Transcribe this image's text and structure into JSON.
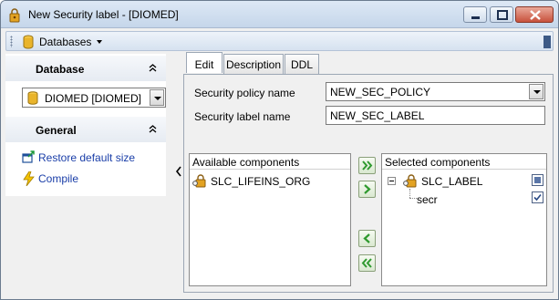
{
  "window": {
    "title": "New Security label - [DIOMED]"
  },
  "toolbar": {
    "databases_label": "Databases"
  },
  "sidebar": {
    "database_header": "Database",
    "database_selected": "DIOMED [DIOMED]",
    "general_header": "General",
    "links": [
      {
        "label": "Restore default size",
        "icon": "restore-size-icon"
      },
      {
        "label": "Compile",
        "icon": "lightning-icon"
      }
    ]
  },
  "tabs": [
    {
      "label": "Edit",
      "active": true
    },
    {
      "label": "Description",
      "active": false
    },
    {
      "label": "DDL",
      "active": false
    }
  ],
  "form": {
    "policy_label": "Security policy name",
    "policy_value": "NEW_SEC_POLICY",
    "label_name_label": "Security label name",
    "label_name_value": "NEW_SEC_LABEL"
  },
  "available": {
    "header": "Available components",
    "items": [
      "SLC_LIFEINS_ORG"
    ]
  },
  "selected": {
    "header": "Selected components",
    "root": "SLC_LABEL",
    "children": [
      "secr"
    ]
  },
  "colors": {
    "link": "#1a3ea8",
    "titlebar": "#c5d6ea",
    "move_button_green": "#2f9a2f"
  }
}
